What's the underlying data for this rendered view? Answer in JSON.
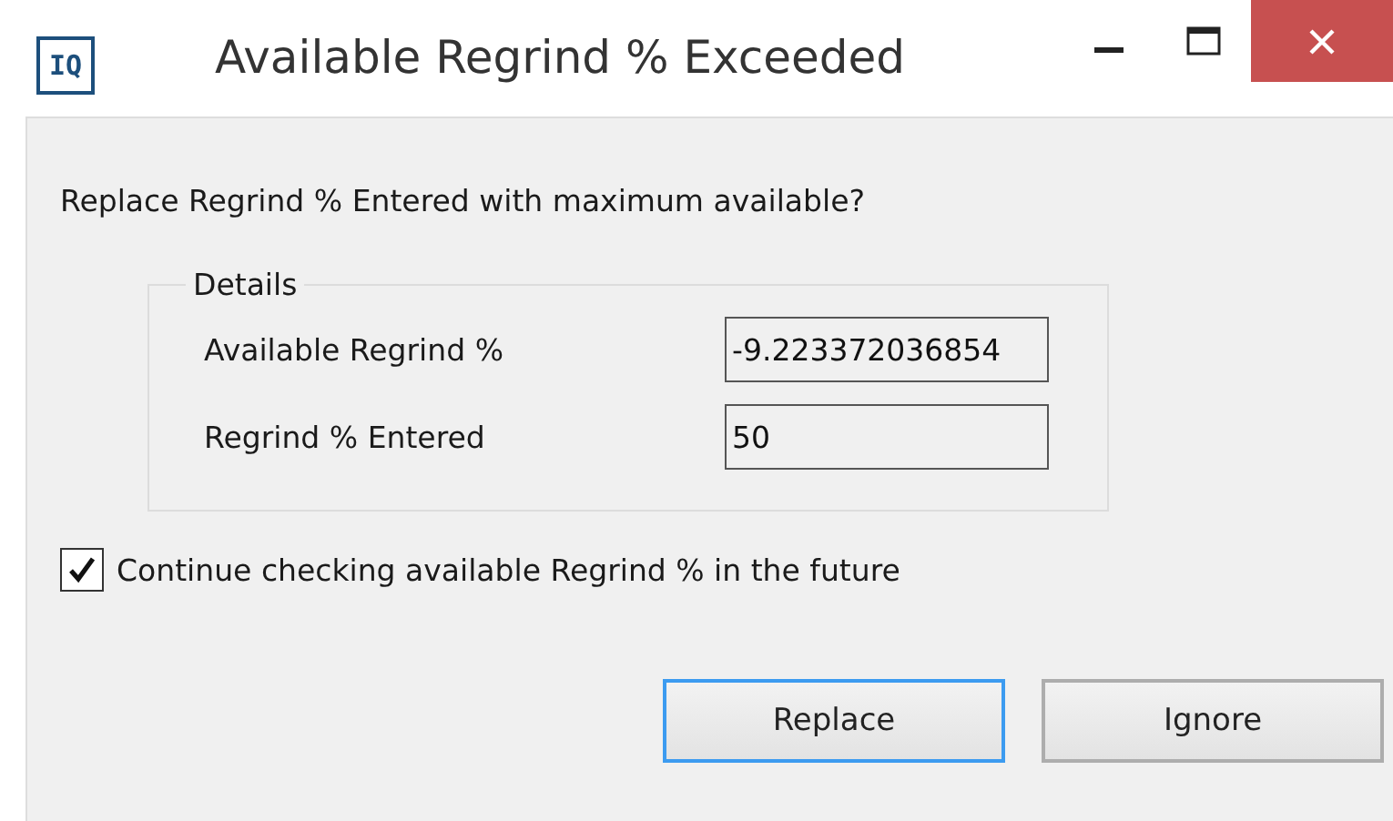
{
  "window": {
    "title": "Available Regrind % Exceeded",
    "icon_text": "IQ",
    "controls": [
      {
        "kind": "minimize"
      },
      {
        "kind": "maximize"
      },
      {
        "kind": "close"
      }
    ]
  },
  "question": "Replace Regrind % Entered with maximum available?",
  "details": {
    "legend": "Details",
    "fields": [
      {
        "label": "Available Regrind %",
        "value": "-9.223372036854"
      },
      {
        "label": "Regrind % Entered",
        "value": "50"
      }
    ]
  },
  "checkbox": {
    "label": "Continue checking available Regrind % in the future",
    "checked": true
  },
  "buttons": [
    {
      "label": "Replace",
      "focused": true
    },
    {
      "label": "Ignore",
      "focused": false
    }
  ]
}
